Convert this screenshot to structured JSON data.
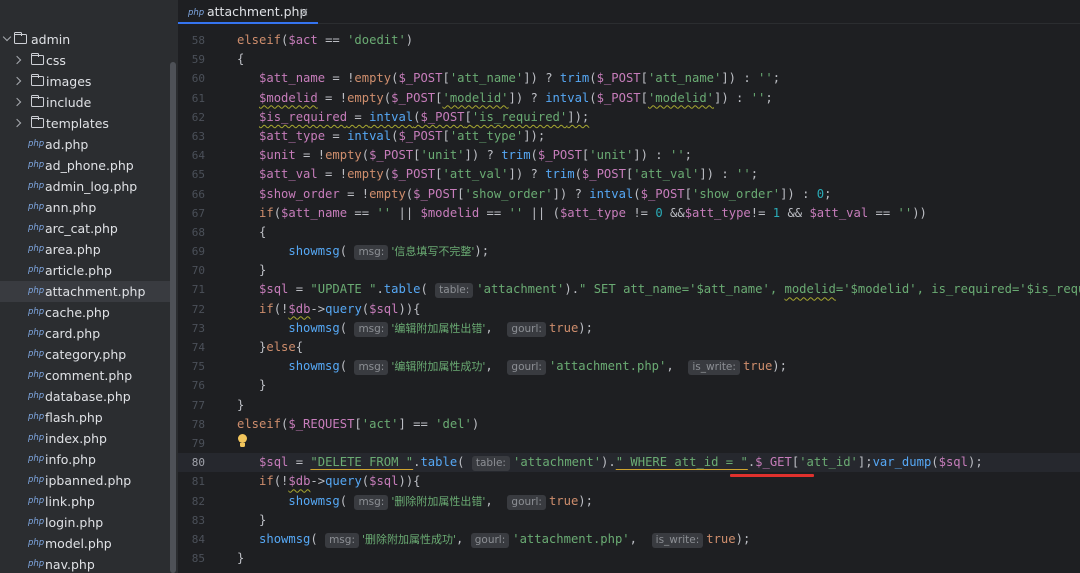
{
  "sidebar": {
    "root": "admin",
    "folders": [
      "css",
      "images",
      "include",
      "templates"
    ],
    "file_icon_label": "php",
    "files": [
      "ad.php",
      "ad_phone.php",
      "admin_log.php",
      "ann.php",
      "arc_cat.php",
      "area.php",
      "article.php",
      "attachment.php",
      "cache.php",
      "card.php",
      "category.php",
      "comment.php",
      "database.php",
      "flash.php",
      "index.php",
      "info.php",
      "ipbanned.php",
      "link.php",
      "login.php",
      "model.php",
      "nav.php"
    ],
    "selected_file": "attachment.php"
  },
  "editor": {
    "tab": {
      "icon_label": "php",
      "name": "attachment.php",
      "close": "×"
    },
    "current_line": "80",
    "line_numbers": [
      "58",
      "59",
      "60",
      "61",
      "62",
      "63",
      "64",
      "65",
      "66",
      "67",
      "68",
      "69",
      "70",
      "71",
      "72",
      "73",
      "74",
      "75",
      "76",
      "77",
      "78",
      "79",
      "80",
      "81",
      "82",
      "83",
      "84",
      "85"
    ],
    "hints": {
      "msg": "msg:",
      "table": "table:",
      "gourl": "gourl:",
      "is_write": "is_write:"
    },
    "strings": {
      "doedit": "'doedit'",
      "empty": "''",
      "att_name": "'att_name'",
      "modelid": "'modelid'",
      "is_required": "'is_required'",
      "att_type": "'att_type'",
      "unit": "'unit'",
      "att_val": "'att_val'",
      "show_order": "'show_order'",
      "msg_incomplete": "'信息填写不完整'",
      "update_sql": "\"UPDATE \"",
      "attachment": "'attachment'",
      "update_set": "\" SET att_name='$att_name', ",
      "update_modelid": "modelid",
      "update_rest": "='$modelid', is_required='$is_required',",
      "msg_edit_error": "'编辑附加属性出错'",
      "msg_edit_ok": "'编辑附加属性成功'",
      "attachment_php": "'attachment.php'",
      "act": "'act'",
      "del": "'del'",
      "delete_from": "\"DELETE FROM \"",
      "where_clause": "\" WHERE att_id = \"",
      "att_id": "'att_id'",
      "msg_del_error": "'删除附加属性出错'",
      "msg_del_ok": "'删除附加属性成功'"
    }
  }
}
